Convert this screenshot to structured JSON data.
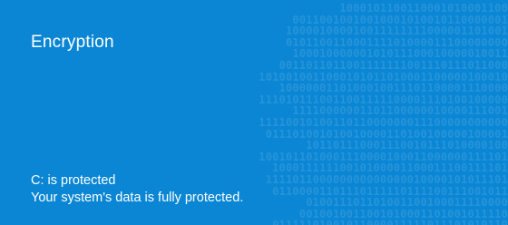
{
  "tile": {
    "title": "Encryption",
    "status_line": "C: is protected",
    "detail_line": "Your system's data is fully protected."
  },
  "colors": {
    "background": "#0a86d4",
    "text": "#ffffff"
  },
  "background_pattern": "binary-digits-pattern"
}
